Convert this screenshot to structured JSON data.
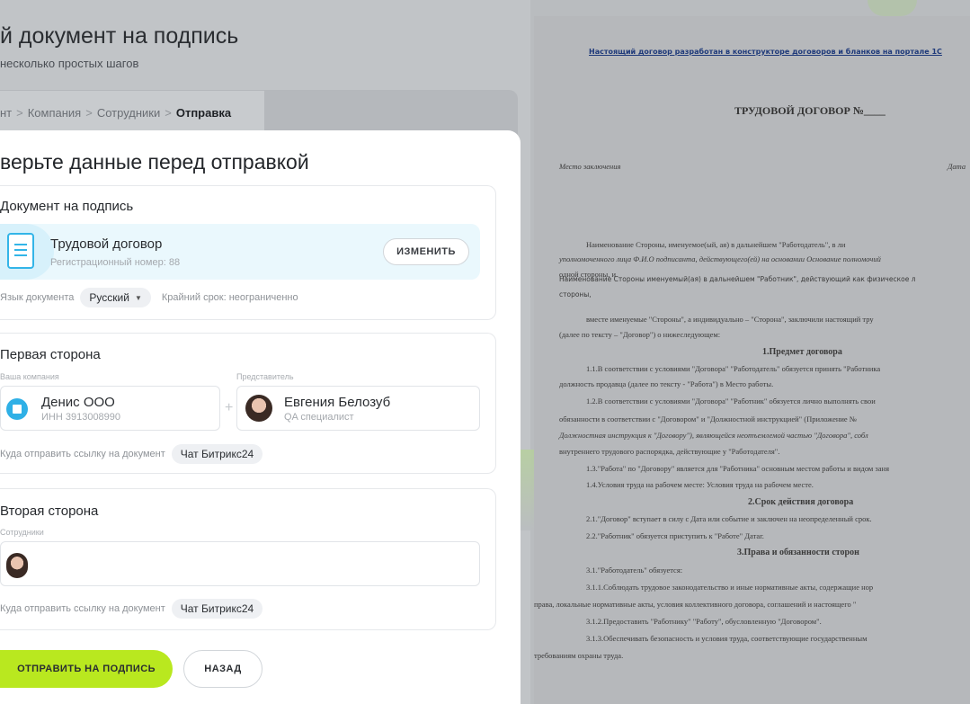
{
  "header": {
    "title": "й документ на подпись",
    "subtitle": "несколько простых шагов"
  },
  "breadcrumb": {
    "items": [
      "нт",
      "Компания",
      "Сотрудники"
    ],
    "active": "Отправка"
  },
  "card": {
    "title": "верьте данные перед отправкой"
  },
  "document_section": {
    "title": "Документ на подпись",
    "doc_name": "Трудовой договор",
    "reg_number": "Регистрационный номер: 88",
    "change_label": "ИЗМЕНИТЬ",
    "lang_label": "Язык документа",
    "lang_value": "Русский",
    "deadline": "Крайний срок: неограниченно"
  },
  "first_party": {
    "title": "Первая сторона",
    "company_label": "Ваша компания",
    "rep_label": "Представитель",
    "company_name": "Денис ООО",
    "company_inn": "ИНН 3913008990",
    "rep_name": "Евгения Белозуб",
    "rep_role": "QA специалист",
    "send_label": "Куда отправить ссылку на документ",
    "send_value": "Чат Битрикс24"
  },
  "second_party": {
    "title": "Вторая сторона",
    "employees_label": "Сотрудники",
    "send_label": "Куда отправить ссылку на документ",
    "send_value": "Чат Битрикс24"
  },
  "actions": {
    "send": "ОТПРАВИТЬ НА ПОДПИСЬ",
    "back": "НАЗАД"
  },
  "preview": {
    "link": "Настоящий договор разработан в конструкторе договоров и бланков на портале 1С",
    "title": "ТРУДОВОЙ ДОГОВОР №____",
    "place": "Место заключения",
    "date": "Дата",
    "l1": "Наименование Стороны, именуемое(ый, ая) в дальнейшем \"Работодатель\", в ли",
    "l2": "уполномоченного лица Ф.И.О подписанта, действующего(ей) на основании Основание полномочий",
    "l3": "одной стороны, и",
    "l4": "Наименование Стороны именуемый(ая) в дальнейшем \"Работник\", действующий как физическое л",
    "l5": "стороны,",
    "l6": "вместе именуемые \"Стороны\", а индивидуально – \"Сторона\", заключили настоящий тру",
    "l7": "(далее по тексту – \"Договор\") о нижеследующем:",
    "h1": "1.Предмет договора",
    "l8": "1.1.В соответствии с условиями \"Договора\" \"Работодатель\" обязуется принять \"Работника",
    "l9": "должность продавца (далее по тексту - \"Работа\") в Место работы.",
    "l10": "1.2.В соответствии с условиями \"Договора\" \"Работник\" обязуется лично выполнять свои",
    "l11": "обязанности в соответствии с \"Договором\" и \"Должностной инструкцией\" (Приложение №",
    "l12": "Должностная инструкция к \"Договору\"), являющейся неотъемлемой частью \"Договора\", собл",
    "l13": "внутреннего трудового распорядка, действующие у \"Работодателя\".",
    "l14": "1.3.\"Работа\" по \"Договору\" является для \"Работника\" основным местом работы и видом заня",
    "l15": "1.4.Условия труда на рабочем месте: Условия труда на рабочем месте.",
    "h2": "2.Срок действия договора",
    "l16": "2.1.\"Договор\" вступает в силу с Дата или событие и заключен на неопределенный срок.",
    "l17": "2.2.\"Работник\" обязуется приступить к \"Работе\" Датаг.",
    "h3": "3.Права и обязанности сторон",
    "l18": "3.1.\"Работодатель\" обязуется:",
    "l19": "3.1.1.Соблюдать трудовое законодательство и иные нормативные акты, содержащие нор",
    "l20": "права, локальные нормативные акты, условия коллективного договора, соглашений и настоящего \"",
    "l21": "3.1.2.Предоставить \"Работнику\" \"Работу\", обусловленную \"Договором\".",
    "l22": "3.1.3.Обеспечивать безопасность и условия труда, соответствующие государственным",
    "l23": "требованиям охраны труда."
  }
}
